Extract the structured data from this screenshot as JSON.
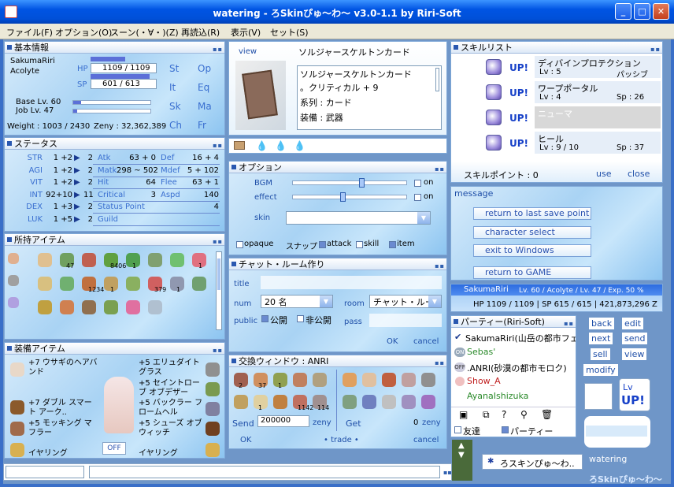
{
  "window": {
    "title": "watering - ろSkinぴゅ〜わ〜 v3.0-1.1 by Riri-Soft",
    "min": "_",
    "max": "□",
    "close": "✕"
  },
  "menu": [
    "ファイル(F)",
    "オプション(O)",
    "スーン(・∀・)(Z)",
    "再読込(R)",
    "表示(V)",
    "セット(S)"
  ],
  "basic": {
    "title": "基本情報",
    "name": "SakumaRiri",
    "job": "Acolyte",
    "hp_label": "HP",
    "hp": "1109 / 1109",
    "sp_label": "SP",
    "sp": "601 / 613",
    "base": "Base Lv. 60",
    "joblv": "Job Lv. 47",
    "weight": "Weight : 1003 / 2430",
    "zeny": "Zeny : 32,362,389",
    "tabs": [
      "St",
      "Op",
      "It",
      "Eq",
      "Sk",
      "Ma",
      "Ch",
      "Fr"
    ]
  },
  "status": {
    "title": "ステータス",
    "rows": [
      {
        "stat": "STR",
        "val": "1 +2",
        "pts": "2",
        "k1": "Atk",
        "v1": "63 + 0",
        "k2": "Def",
        "v2": "16 + 4"
      },
      {
        "stat": "AGI",
        "val": "1 +2",
        "pts": "2",
        "k1": "Matk",
        "v1": "298 ~ 502",
        "k2": "Mdef",
        "v2": "5 + 102"
      },
      {
        "stat": "VIT",
        "val": "1 +2",
        "pts": "2",
        "k1": "Hit",
        "v1": "64",
        "k2": "Flee",
        "v2": "63 + 1"
      },
      {
        "stat": "INT",
        "val": "92+10",
        "pts": "11",
        "k1": "Critical",
        "v1": "3",
        "k2": "Aspd",
        "v2": "140"
      },
      {
        "stat": "DEX",
        "val": "1 +3",
        "pts": "2",
        "k1": "Status Point",
        "v1": "",
        "k2": "",
        "v2": "4"
      },
      {
        "stat": "LUK",
        "val": "1 +5",
        "pts": "2",
        "k1": "Guild",
        "v1": "",
        "k2": "",
        "v2": ""
      }
    ]
  },
  "items": {
    "title": "所持アイテム",
    "counts": [
      "",
      "47",
      "",
      "8406",
      "1",
      "",
      "",
      "1",
      "",
      "",
      "1234",
      "1",
      "",
      "379",
      "1",
      "",
      "",
      "",
      "",
      "",
      "",
      ""
    ]
  },
  "equip": {
    "title": "装備アイテム",
    "left": [
      "+7 ウサギのヘアバンド",
      "+7 ダブル スマート アーク..",
      "+5 モッキング マフラー",
      "イヤリング"
    ],
    "right": [
      "+5 エリュダイト グラス",
      "+5 セイントローブ オブデザー",
      "+5 バックラー フロームヘル",
      "+5 シューズ オブ ウィッチ",
      "イヤリング"
    ],
    "off": "OFF"
  },
  "card": {
    "view": "view",
    "title": "ソルジャースケルトンカード",
    "desc": [
      "ソルジャースケルトンカード",
      "。クリティカル + 9",
      "系列 : カード",
      "装備 : 武器"
    ]
  },
  "options": {
    "title": "オプション",
    "bgm": "BGM",
    "effect": "effect",
    "skin": "skin",
    "on": "on",
    "opaque": "opaque",
    "snap": "スナップ",
    "attack": "attack",
    "skill": "skill",
    "item": "item"
  },
  "chat": {
    "title": "チャット・ルーム作り",
    "title_label": "title",
    "num_label": "num",
    "num": "20 名",
    "room_label": "room",
    "room": "チャット・ルー",
    "public_label": "public",
    "open": "公開",
    "closed": "非公開",
    "pass_label": "pass",
    "ok": "OK",
    "cancel": "cancel"
  },
  "trade": {
    "title": "交換ウィンドウ : ANRI",
    "send": "Send",
    "send_value": "200000",
    "zeny": "zeny",
    "get": "Get",
    "get_value": "0",
    "counts_left": [
      "2",
      "37",
      "1",
      "",
      "",
      "",
      "1",
      "",
      "1142",
      "114"
    ],
    "ok": "OK",
    "trade": "• trade •",
    "cancel": "cancel"
  },
  "skills": {
    "title": "スキルリスト",
    "up": "UP!",
    "list": [
      {
        "name": "ディバインプロテクション",
        "lv": "Lv : 5",
        "extra": "パッシブ"
      },
      {
        "name": "ワープポータル",
        "lv": "Lv : 4",
        "extra": "Sp : 26"
      },
      {
        "name": "ニューマ",
        "lv": "",
        "extra": ""
      },
      {
        "name": "ヒール",
        "lv": "Lv : 9 / 10",
        "extra": "Sp : 37"
      }
    ],
    "points": "スキルポイント : 0",
    "use": "use",
    "close": "close"
  },
  "message": {
    "title": "message",
    "buttons": [
      "return to last save point",
      "character select",
      "exit to Windows",
      "return to GAME"
    ]
  },
  "charinfo": {
    "name": "SakumaRiri",
    "line1": "Lv. 60 / Acolyte / Lv. 47 / Exp. 50 %",
    "line2": "HP 1109 / 1109 | SP 615 / 615 | 421,873,296 Z"
  },
  "party": {
    "title": "パーティー(Riri-Soft)",
    "members": [
      "SakumaRiri(山岳の都市フェ",
      "Sebas'",
      ".ANRI(砂漠の都市モロク)",
      "Show_A",
      "AyanaIshizuka"
    ],
    "friend": "友達",
    "party": "パーティー"
  },
  "side": {
    "back": "back",
    "edit": "edit",
    "next": "next",
    "send": "send",
    "sell": "sell",
    "view": "view",
    "modify": "modify",
    "lv": "Lv",
    "up": "UP!"
  },
  "bottom": {
    "watering": "watering",
    "logo": "ろSkinぴゅ〜わ〜",
    "task": "ろスキンぴゅ〜わ.."
  }
}
